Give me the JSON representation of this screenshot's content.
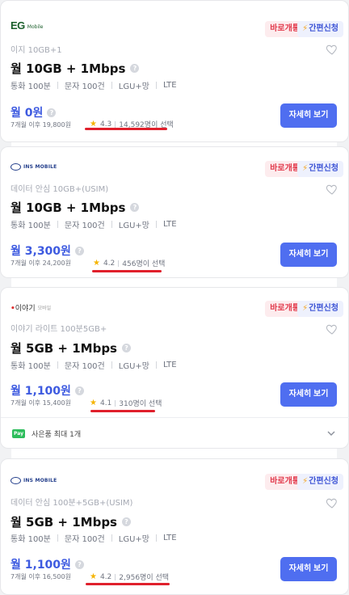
{
  "common": {
    "open_tag": "바로개통",
    "easy_tag": "간편신청",
    "detail_button": "자세히 보기",
    "calls": "통화 100분",
    "sms": "문자 100건",
    "network": "LGU+망",
    "tech": "LTE"
  },
  "cards": [
    {
      "logo": {
        "main": "EG",
        "sub": "Mobile"
      },
      "plan_name": "이지 10GB+1",
      "title": "월 10GB + 1Mbps",
      "price": "월 0원",
      "after": "7개월 이후 19,800원",
      "rating": "4.3",
      "selections": "14,592명이 선택"
    },
    {
      "logo": {
        "main": "INS MOBILE"
      },
      "plan_name": "데이터 안심 10GB+(USIM)",
      "title": "월 10GB + 1Mbps",
      "price": "월 3,300원",
      "after": "7개월 이후 24,200원",
      "rating": "4.2",
      "selections": "456명이 선택"
    },
    {
      "logo": {
        "main": "이야기",
        "sub": "모바일"
      },
      "plan_name": "이야기 라이트 100분5GB+",
      "title": "월 5GB + 1Mbps",
      "price": "월 1,100원",
      "after": "7개월 이후 15,400원",
      "rating": "4.1",
      "selections": "310명이 선택",
      "gift": {
        "icon": "Pay",
        "text": "사은품 최대 1개"
      }
    },
    {
      "logo": {
        "main": "INS MOBILE"
      },
      "plan_name": "데이터 안심 100분+5GB+(USIM)",
      "title": "월 5GB + 1Mbps",
      "price": "월 1,100원",
      "after": "7개월 이후 16,500원",
      "rating": "4.2",
      "selections": "2,956명이 선택"
    }
  ],
  "colors": {
    "accent": "#4f6ef0",
    "price": "#3d5ae0",
    "open_tag": "#e23a4c",
    "underline": "#e0202c"
  }
}
